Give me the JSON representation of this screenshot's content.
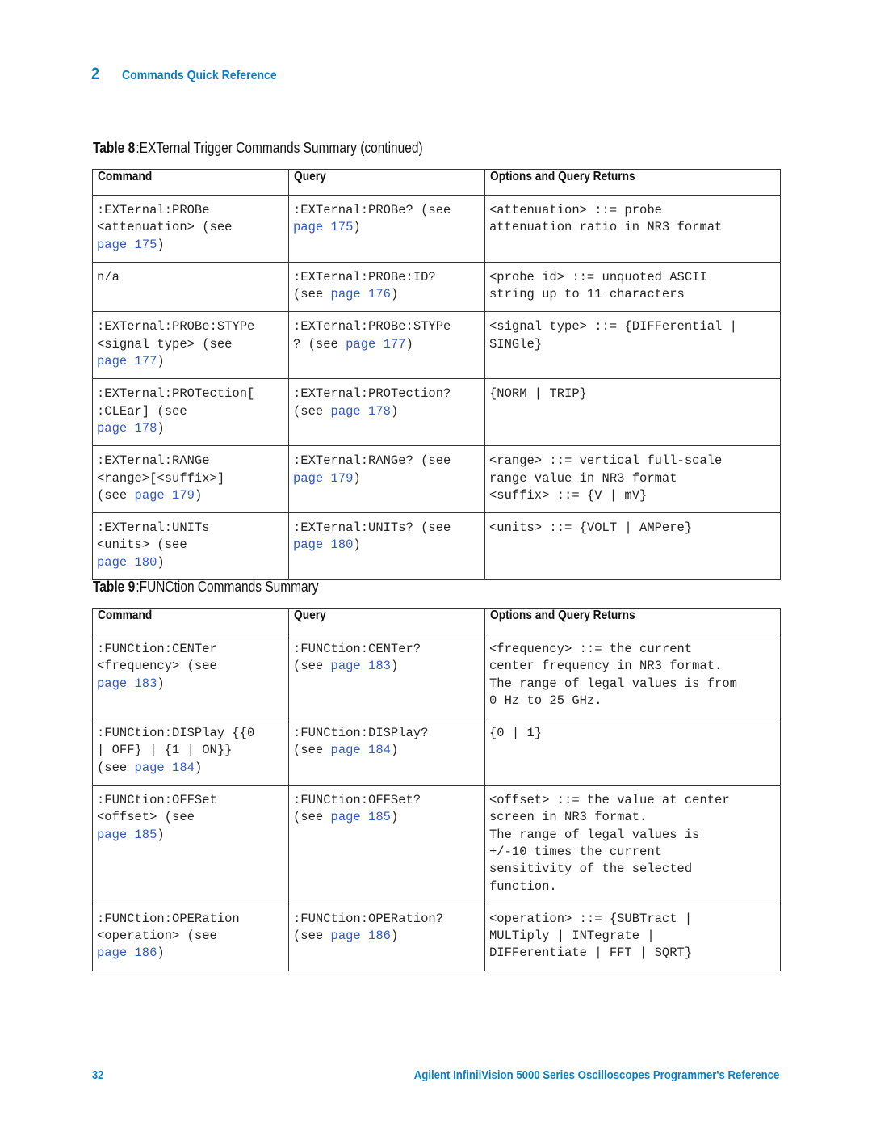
{
  "header": {
    "chapter_number": "2",
    "chapter_title": "Commands Quick Reference"
  },
  "colors": {
    "accent_blue": "#0a7fc4",
    "link_blue": "#2f58c8",
    "border": "#333333"
  },
  "table8": {
    "label": "Table 8",
    "title": ":EXTernal Trigger Commands Summary (continued)",
    "columns": [
      "Command",
      "Query",
      "Options and Query Returns"
    ],
    "rows": [
      {
        "command": [
          ":EXTernal:PROBe",
          "<attenuation> (see",
          {
            "link": "page 175",
            "suffix": ")"
          }
        ],
        "query": [
          ":EXTernal:PROBe? (see",
          {
            "link": "page 175",
            "suffix": ")"
          }
        ],
        "options": [
          "<attenuation> ::= probe",
          "attenuation ratio in NR3 format"
        ]
      },
      {
        "command": [
          "n/a"
        ],
        "query": [
          ":EXTernal:PROBe:ID?",
          {
            "prefix": "(see ",
            "link": "page 176",
            "suffix": ")"
          }
        ],
        "options": [
          "<probe id> ::= unquoted ASCII",
          "string up to 11 characters"
        ]
      },
      {
        "command": [
          ":EXTernal:PROBe:STYPe",
          "<signal type> (see",
          {
            "link": "page 177",
            "suffix": ")"
          }
        ],
        "query": [
          ":EXTernal:PROBe:STYPe",
          {
            "prefix": "? (see ",
            "link": "page 177",
            "suffix": ")"
          }
        ],
        "options": [
          "<signal type> ::= {DIFFerential |",
          "SINGle}"
        ]
      },
      {
        "command": [
          ":EXTernal:PROTection[",
          ":CLEar] (see",
          {
            "link": "page 178",
            "suffix": ")"
          }
        ],
        "query": [
          ":EXTernal:PROTection?",
          {
            "prefix": "(see ",
            "link": "page 178",
            "suffix": ")"
          }
        ],
        "options": [
          "{NORM | TRIP}"
        ]
      },
      {
        "command": [
          ":EXTernal:RANGe",
          "<range>[<suffix>]",
          {
            "prefix": "(see ",
            "link": "page 179",
            "suffix": ")"
          }
        ],
        "query": [
          ":EXTernal:RANGe? (see",
          {
            "link": "page 179",
            "suffix": ")"
          }
        ],
        "options": [
          "<range> ::= vertical full-scale",
          "range value in NR3 format",
          "<suffix> ::= {V | mV}"
        ]
      },
      {
        "command": [
          ":EXTernal:UNITs",
          "<units> (see",
          {
            "link": "page 180",
            "suffix": ")"
          }
        ],
        "query": [
          ":EXTernal:UNITs? (see",
          {
            "link": "page 180",
            "suffix": ")"
          }
        ],
        "options": [
          "<units> ::= {VOLT | AMPere}"
        ]
      }
    ]
  },
  "table9": {
    "label": "Table 9",
    "title": ":FUNCtion Commands Summary",
    "columns": [
      "Command",
      "Query",
      "Options and Query Returns"
    ],
    "rows": [
      {
        "command": [
          ":FUNCtion:CENTer",
          "<frequency> (see",
          {
            "link": "page 183",
            "suffix": ")"
          }
        ],
        "query": [
          ":FUNCtion:CENTer?",
          {
            "prefix": "(see ",
            "link": "page 183",
            "suffix": ")"
          }
        ],
        "options": [
          "<frequency> ::= the current",
          "center frequency in NR3 format.",
          "The range of legal values is from",
          "0 Hz to 25 GHz."
        ]
      },
      {
        "command": [
          ":FUNCtion:DISPlay {{0",
          "| OFF} | {1 | ON}}",
          {
            "prefix": "(see ",
            "link": "page 184",
            "suffix": ")"
          }
        ],
        "query": [
          ":FUNCtion:DISPlay?",
          {
            "prefix": "(see ",
            "link": "page 184",
            "suffix": ")"
          }
        ],
        "options": [
          "{0 | 1}"
        ]
      },
      {
        "command": [
          ":FUNCtion:OFFSet",
          "<offset> (see",
          {
            "link": "page 185",
            "suffix": ")"
          }
        ],
        "query": [
          ":FUNCtion:OFFSet?",
          {
            "prefix": "(see ",
            "link": "page 185",
            "suffix": ")"
          }
        ],
        "options": [
          "<offset> ::= the value at center",
          "screen in NR3 format.",
          "The range of legal values is",
          "+/-10 times the current",
          "sensitivity of the selected",
          "function."
        ]
      },
      {
        "command": [
          ":FUNCtion:OPERation",
          "<operation> (see",
          {
            "link": "page 186",
            "suffix": ")"
          }
        ],
        "query": [
          ":FUNCtion:OPERation?",
          {
            "prefix": "(see ",
            "link": "page 186",
            "suffix": ")"
          }
        ],
        "options": [
          "<operation> ::= {SUBTract |",
          "MULTiply | INTegrate |",
          "DIFFerentiate | FFT | SQRT}"
        ]
      }
    ]
  },
  "footer": {
    "page_number": "32",
    "book_title": "Agilent InfiniiVision 5000 Series Oscilloscopes Programmer's Reference"
  }
}
